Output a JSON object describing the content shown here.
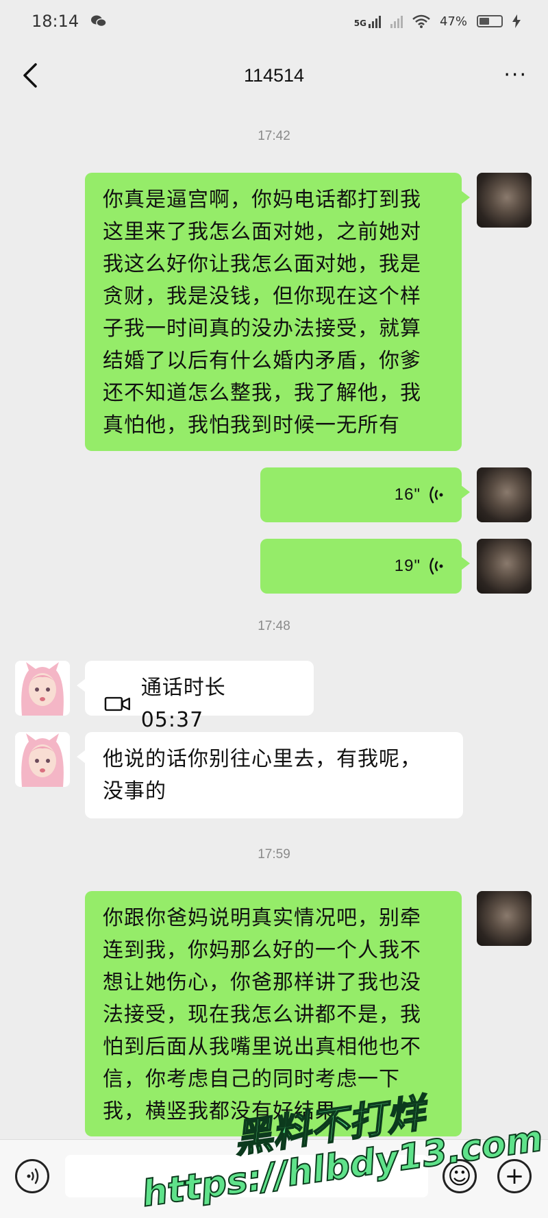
{
  "status_bar": {
    "time": "18:14",
    "network": "5G",
    "battery": "47%",
    "battery_level": 0.47,
    "icons": [
      "wechat-icon",
      "signal-icon",
      "wifi-icon",
      "battery-icon",
      "charging-icon"
    ]
  },
  "header": {
    "title": "114514",
    "back_icon": "chevron-left-icon",
    "more_icon": "more-dots-icon",
    "more_label": "···"
  },
  "timestamps": [
    "17:42",
    "17:48",
    "17:59"
  ],
  "messages": [
    {
      "sender": "me",
      "type": "text",
      "lines": [
        "你真是逼宫啊，你妈电话都打到我",
        "这里来了我怎么面对她，之前她对",
        "我这么好你让我怎么面对她，我是",
        "贪财，我是没钱，但你现在这个样",
        "子我一时间真的没办法接受，就算",
        "结婚了以后有什么婚内矛盾，你爹",
        "还不知道怎么整我，我了解他，我",
        "真怕他，我怕我到时候一无所有"
      ]
    },
    {
      "sender": "me",
      "type": "voice",
      "duration": "16\""
    },
    {
      "sender": "me",
      "type": "voice",
      "duration": "19\""
    },
    {
      "sender": "them",
      "type": "call",
      "text": "通话时长 05:37"
    },
    {
      "sender": "them",
      "type": "text",
      "lines": [
        "他说的话你别往心里去，有我呢，",
        "没事的"
      ]
    },
    {
      "sender": "me",
      "type": "text",
      "lines": [
        "你跟你爸妈说明真实情况吧，别牵",
        "连到我，你妈那么好的一个人我不",
        "想让她伤心，你爸那样讲了我也没",
        "法接受，现在我怎么讲都不是，我",
        "怕到后面从我嘴里说出真相他也不",
        "信，你考虑自己的同时考虑一下",
        "我，横竖我都没有好结果"
      ]
    }
  ],
  "input_bar": {
    "voice_icon": "voice-input-icon",
    "emoji_icon": "emoji-icon",
    "plus_icon": "plus-icon",
    "emoji_glyph": "☺",
    "plus_glyph": "+"
  },
  "watermark": {
    "line1": "黑料不打烊",
    "line2": "https://hlbdy13.com"
  },
  "colors": {
    "background": "#ededed",
    "bubble_me": "#95ec69",
    "bubble_them": "#ffffff",
    "watermark": "#5fe28a"
  }
}
